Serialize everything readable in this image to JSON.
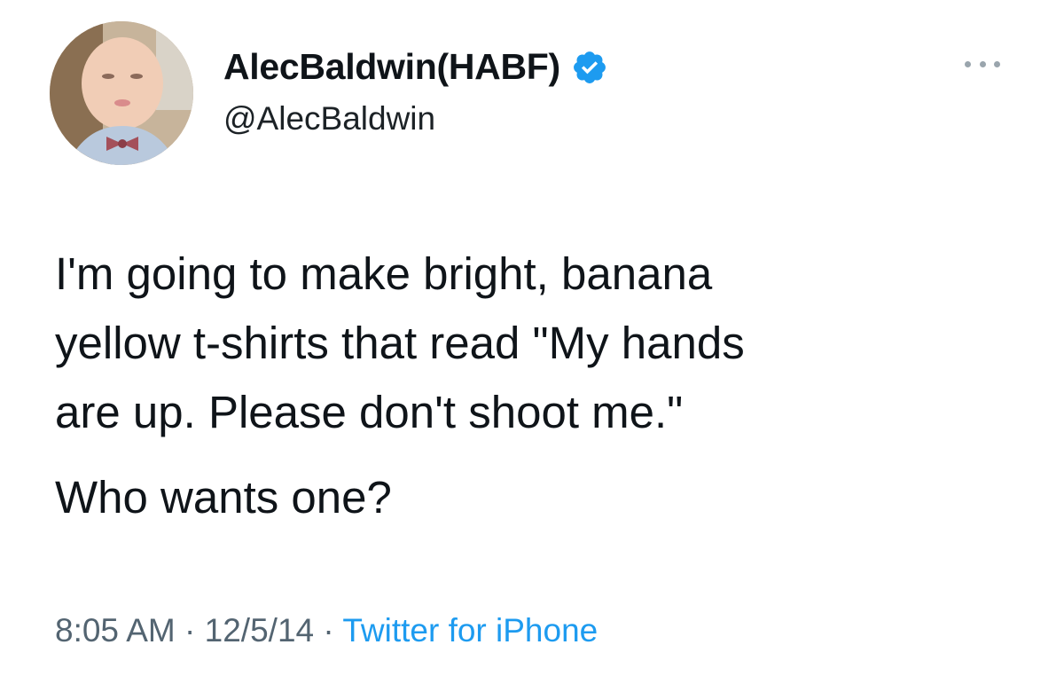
{
  "author": {
    "display_name": "AlecBaldwin(HABF)",
    "handle": "@AlecBaldwin",
    "verified": true,
    "verified_icon": "verified-badge-icon",
    "avatar_icon": "profile-photo-avatar"
  },
  "more_menu_icon": "more-options-icon",
  "tweet": {
    "lines": [
      "I'm going to make bright, banana",
      "yellow t-shirts that read \"My hands",
      "are up. Please don't shoot me.\""
    ],
    "second_paragraph": "Who wants one?"
  },
  "meta": {
    "time": "8:05 AM",
    "separator": " · ",
    "date": "12/5/14",
    "source": "Twitter for iPhone"
  },
  "colors": {
    "text": "#0f1419",
    "secondary": "#536471",
    "accent": "#1d9bf0",
    "background": "#ffffff"
  }
}
